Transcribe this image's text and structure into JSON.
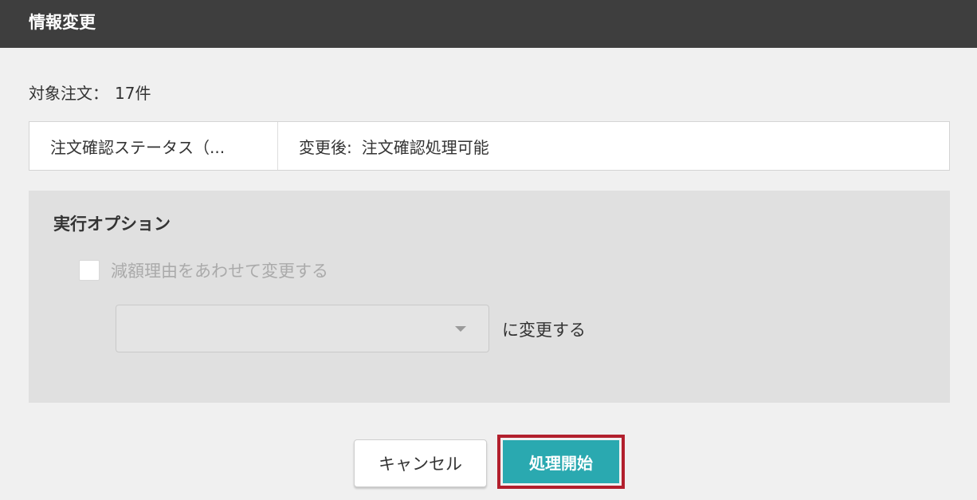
{
  "dialog": {
    "title": "情報変更"
  },
  "target": {
    "label": "対象注文：",
    "count": "17件"
  },
  "change_row": {
    "field": "注文確認ステータス（...",
    "after_label": "変更後:",
    "after_value": "注文確認処理可能"
  },
  "options": {
    "heading": "実行オプション",
    "checkbox_label": "減額理由をあわせて変更する",
    "checkbox_checked": false,
    "select_value": "",
    "select_suffix": "に変更する"
  },
  "buttons": {
    "cancel": "キャンセル",
    "start": "処理開始"
  },
  "colors": {
    "titlebar_bg": "#3e3e3e",
    "primary": "#2aa9b0",
    "highlight_border": "#b21f2d"
  }
}
